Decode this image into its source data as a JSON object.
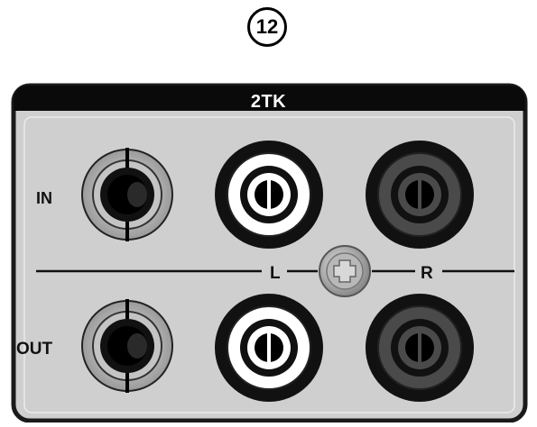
{
  "badge": {
    "number": "12"
  },
  "panel": {
    "title": "2TK"
  },
  "labels": {
    "in": "IN",
    "out": "OUT",
    "left": "L",
    "right": "R"
  },
  "colors": {
    "panel_fill": "#cfcfcf",
    "panel_border": "#1a1a1a",
    "header": "#0a0a0a",
    "left_channel_ring": "#ffffff",
    "right_channel_ring": "#4a4a4a"
  }
}
